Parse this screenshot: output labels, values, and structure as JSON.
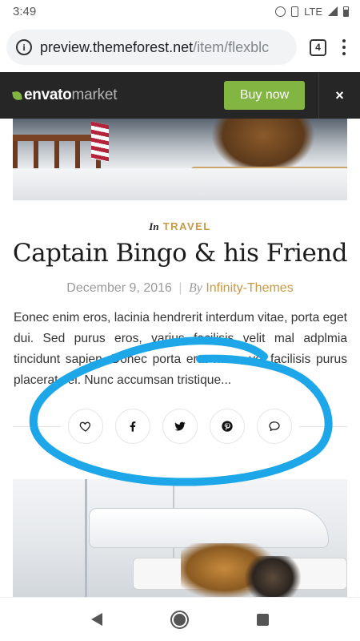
{
  "status_bar": {
    "time": "3:49",
    "network": "LTE"
  },
  "browser": {
    "url_host": "preview.themeforest.net",
    "url_path": "/item/flexblc",
    "tab_count": "4"
  },
  "envato_bar": {
    "logo_brand": "envato",
    "logo_sub": "market",
    "buy_label": "Buy now",
    "close_label": "×"
  },
  "post": {
    "category_prefix": "In",
    "category": "TRAVEL",
    "title": "Captain Bingo & his Friend",
    "date": "December 9, 2016",
    "separator": "|",
    "by_prefix": "By",
    "author": "Infinity-Themes",
    "excerpt": "Eonec enim eros, lacinia hendrerit interdum vitae, porta eget dui. Sed purus eros, varius facilisis velit mal adplmia tincidunt sapien. Donec porta erat nunc, vel facilisis purus placerat vel. Nunc accumsan tristique..."
  },
  "share_buttons": [
    {
      "icon": "heart-icon"
    },
    {
      "icon": "facebook-icon"
    },
    {
      "icon": "twitter-icon"
    },
    {
      "icon": "pinterest-icon"
    },
    {
      "icon": "comment-icon"
    }
  ],
  "colors": {
    "accent": "#c89a45",
    "buy_button": "#82b541",
    "envato_bar": "#262626",
    "annotation": "#1ea7e8"
  }
}
